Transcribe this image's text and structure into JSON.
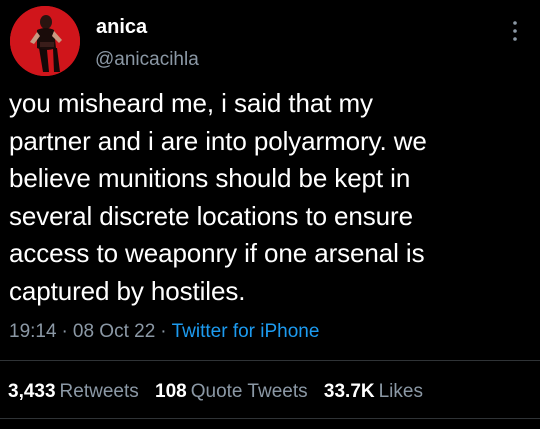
{
  "user": {
    "display_name": "anica",
    "handle": "@anicacihla",
    "avatar_bg": "#d0151b"
  },
  "tweet": {
    "lines": [
      "you misheard me, i said that my",
      "partner and i are into polyarmory. we",
      "believe munitions should be kept in",
      "several discrete locations to ensure",
      "access to weaponry if one arsenal is",
      "captured by hostiles."
    ]
  },
  "meta": {
    "time": "19:14",
    "separator": "·",
    "date": "08 Oct 22",
    "source": "Twitter for iPhone"
  },
  "stats": {
    "retweets_count": "3,433",
    "retweets_label": "Retweets",
    "quotes_count": "108",
    "quotes_label": "Quote Tweets",
    "likes_count": "33.7K",
    "likes_label": "Likes"
  },
  "colors": {
    "background": "#000000",
    "text": "#ffffff",
    "secondary": "#8b98a5",
    "link": "#1d9bf0",
    "divider": "#2f3336"
  },
  "icons": {
    "more": "more-vertical-icon"
  }
}
